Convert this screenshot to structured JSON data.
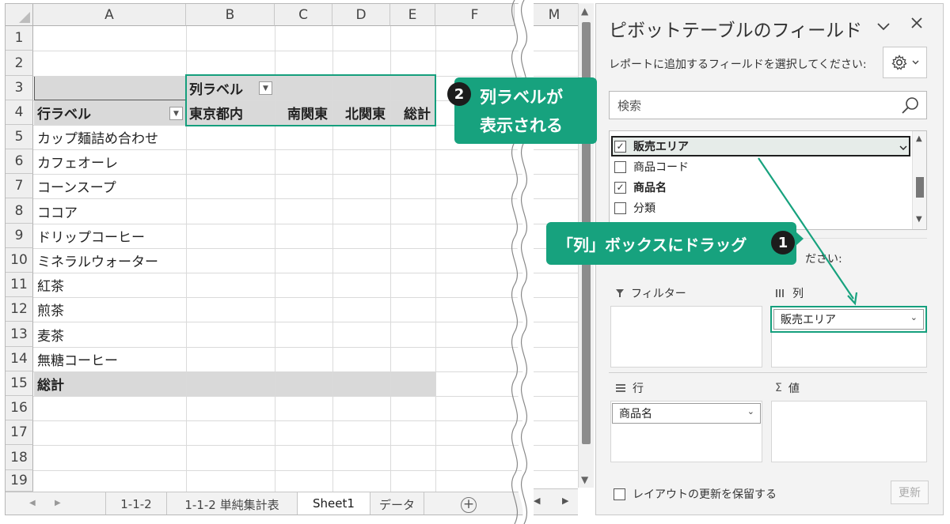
{
  "sheet": {
    "columns": [
      "A",
      "B",
      "C",
      "D",
      "E",
      "F"
    ],
    "rows": [
      "1",
      "2",
      "3",
      "4",
      "5",
      "6",
      "7",
      "8",
      "9",
      "10",
      "11",
      "12",
      "13",
      "14",
      "15",
      "16",
      "17",
      "18",
      "19"
    ],
    "pivot": {
      "col_labels_header": "列ラベル",
      "row_labels_header": "行ラベル",
      "column_items": [
        "東京都内",
        "南関東",
        "北関東",
        "総計"
      ],
      "row_items": [
        "カップ麺詰め合わせ",
        "カフェオーレ",
        "コーンスープ",
        "ココア",
        "ドリップコーヒー",
        "ミネラルウォーター",
        "紅茶",
        "煎茶",
        "麦茶",
        "無糖コーヒー"
      ],
      "grand_total": "総計"
    },
    "tabs": [
      "1-1-2",
      "1-1-2 単純集計表",
      "Sheet1",
      "データ"
    ],
    "active_tab": "Sheet1",
    "extra_column": "M"
  },
  "panel": {
    "title": "ピボットテーブルのフィールド",
    "instruction": "レポートに追加するフィールドを選択してください:",
    "search_placeholder": "検索",
    "fields": [
      {
        "label": "販売エリア",
        "checked": true
      },
      {
        "label": "商品コード",
        "checked": false
      },
      {
        "label": "商品名",
        "checked": true
      },
      {
        "label": "分類",
        "checked": false
      }
    ],
    "partial_text": "ださい:",
    "areas": {
      "filter_label": "フィルター",
      "columns_label": "列",
      "rows_label": "行",
      "values_label": "値",
      "columns_field": "販売エリア",
      "rows_field": "商品名"
    },
    "defer_label": "レイアウトの更新を保留する",
    "update_label": "更新"
  },
  "callouts": {
    "step1_number": "1",
    "step1_text": "「列」ボックスにドラッグ",
    "step2_number": "2",
    "step2_line1": "列ラベルが",
    "step2_line2": "表示される"
  },
  "colors": {
    "accent": "#17a27e",
    "pivot_header": "#d9d9d9",
    "badge": "#1c1c1c"
  }
}
